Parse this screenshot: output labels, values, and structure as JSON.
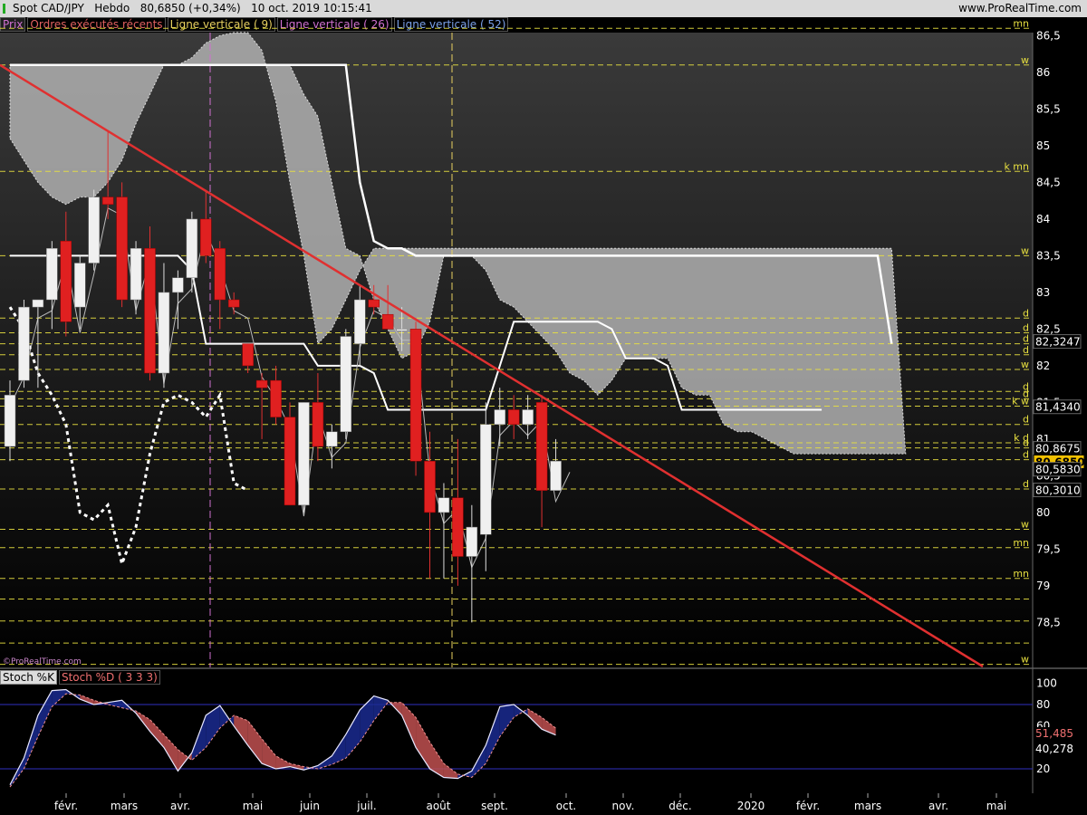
{
  "header": {
    "instrument": "Spot CAD/JPY",
    "timeframe": "Hebdo",
    "price_change": "80,6850 (+0,34%)",
    "datetime": "10 oct. 2019 10:15:41",
    "site": "www.ProRealTime.com"
  },
  "legend": [
    {
      "label": "Prix",
      "color": "#d070d0"
    },
    {
      "label": "Ordres exécutés récents",
      "color": "#e06060"
    },
    {
      "label": "Ligne verticale ( 9)",
      "color": "#e8d060"
    },
    {
      "label": "Ligne verticale ( 26)",
      "color": "#d070d0"
    },
    {
      "label": "Ligne verticale ( 52)",
      "color": "#7aa0e8"
    }
  ],
  "watermark": "©ProRealTime.com",
  "stoch_legend": {
    "k": "Stoch %K",
    "d": "Stoch %D ( 3 3 3)"
  },
  "colors": {
    "up": "#f0f0f0",
    "down": "#e02020",
    "trend": "#e03030",
    "level": "#e8e040",
    "cloud": "#b0b0b0"
  },
  "chart_data": [
    {
      "type": "candlestick",
      "ylim": [
        78.0,
        86.7
      ],
      "yticks": [
        "86,5",
        "86",
        "85,5",
        "85",
        "84,5",
        "84",
        "83,5",
        "83",
        "82,5",
        "82",
        "81,5",
        "81",
        "80,5",
        "80",
        "79,5",
        "79",
        "78,5"
      ],
      "x_labels": [
        "févr.",
        "mars",
        "avr.",
        "mai",
        "juin",
        "juil.",
        "août",
        "sept.",
        "oct.",
        "nov.",
        "déc.",
        "2020",
        "févr.",
        "mars",
        "avr.",
        "mai"
      ],
      "candles": [
        {
          "o": 80.9,
          "h": 81.8,
          "l": 80.7,
          "c": 81.6
        },
        {
          "o": 81.8,
          "h": 82.9,
          "l": 81.7,
          "c": 82.8
        },
        {
          "o": 82.8,
          "h": 82.9,
          "l": 81.7,
          "c": 82.9
        },
        {
          "o": 82.9,
          "h": 83.7,
          "l": 82.5,
          "c": 83.6
        },
        {
          "o": 83.7,
          "h": 84.1,
          "l": 82.4,
          "c": 82.6
        },
        {
          "o": 82.8,
          "h": 83.5,
          "l": 82.5,
          "c": 83.4
        },
        {
          "o": 83.4,
          "h": 84.4,
          "l": 83.3,
          "c": 84.3
        },
        {
          "o": 84.3,
          "h": 85.2,
          "l": 84.0,
          "c": 84.2
        },
        {
          "o": 84.3,
          "h": 84.5,
          "l": 82.8,
          "c": 82.9
        },
        {
          "o": 82.9,
          "h": 83.7,
          "l": 82.7,
          "c": 83.6
        },
        {
          "o": 83.6,
          "h": 83.9,
          "l": 81.8,
          "c": 81.9
        },
        {
          "o": 81.9,
          "h": 83.4,
          "l": 81.7,
          "c": 83.0
        },
        {
          "o": 83.0,
          "h": 83.3,
          "l": 82.5,
          "c": 83.2
        },
        {
          "o": 83.2,
          "h": 84.1,
          "l": 83.0,
          "c": 84.0
        },
        {
          "o": 84.0,
          "h": 84.4,
          "l": 83.4,
          "c": 83.5
        },
        {
          "o": 83.6,
          "h": 83.7,
          "l": 82.5,
          "c": 82.9
        },
        {
          "o": 82.9,
          "h": 83.0,
          "l": 82.7,
          "c": 82.8
        },
        {
          "o": 82.3,
          "h": 82.3,
          "l": 81.9,
          "c": 82.0
        },
        {
          "o": 81.8,
          "h": 81.9,
          "l": 81.0,
          "c": 81.7
        },
        {
          "o": 81.8,
          "h": 82.0,
          "l": 81.2,
          "c": 81.3
        },
        {
          "o": 81.3,
          "h": 81.5,
          "l": 80.1,
          "c": 80.1
        },
        {
          "o": 80.1,
          "h": 81.5,
          "l": 80.0,
          "c": 81.5
        },
        {
          "o": 81.5,
          "h": 81.9,
          "l": 80.7,
          "c": 80.9
        },
        {
          "o": 80.9,
          "h": 81.2,
          "l": 80.6,
          "c": 81.1
        },
        {
          "o": 81.1,
          "h": 82.5,
          "l": 81.0,
          "c": 82.4
        },
        {
          "o": 82.3,
          "h": 83.1,
          "l": 82.0,
          "c": 82.9
        },
        {
          "o": 82.9,
          "h": 83.1,
          "l": 82.7,
          "c": 82.8
        },
        {
          "o": 82.7,
          "h": 83.1,
          "l": 82.5,
          "c": 82.5
        },
        {
          "o": 82.5,
          "h": 82.8,
          "l": 82.2,
          "c": 82.5
        },
        {
          "o": 82.5,
          "h": 82.6,
          "l": 80.5,
          "c": 80.7
        },
        {
          "o": 80.7,
          "h": 81.1,
          "l": 79.1,
          "c": 80.0
        },
        {
          "o": 80.0,
          "h": 80.4,
          "l": 79.1,
          "c": 80.2
        },
        {
          "o": 80.2,
          "h": 81.0,
          "l": 79.0,
          "c": 79.4
        },
        {
          "o": 79.4,
          "h": 80.1,
          "l": 78.5,
          "c": 79.8
        },
        {
          "o": 79.7,
          "h": 81.5,
          "l": 79.2,
          "c": 81.2
        },
        {
          "o": 81.2,
          "h": 81.7,
          "l": 80.9,
          "c": 81.4
        },
        {
          "o": 81.4,
          "h": 81.6,
          "l": 81.0,
          "c": 81.2
        },
        {
          "o": 81.2,
          "h": 81.6,
          "l": 81.0,
          "c": 81.4
        },
        {
          "o": 81.5,
          "h": 81.6,
          "l": 79.8,
          "c": 80.3
        },
        {
          "o": 80.3,
          "h": 81.0,
          "l": 80.3,
          "c": 80.7
        }
      ],
      "price_labels": [
        {
          "label": "82,3247",
          "value": 82.3247,
          "style": "white"
        },
        {
          "label": "81,4340",
          "value": 81.434,
          "style": "white"
        },
        {
          "label": "80,8675",
          "value": 80.8675,
          "style": "white"
        },
        {
          "label": "80,6850",
          "value": 80.685,
          "style": "yellow"
        },
        {
          "label": "80,5830",
          "value": 80.583,
          "style": "white"
        },
        {
          "label": "80,3010",
          "value": 80.301,
          "style": "white"
        }
      ],
      "levels": [
        {
          "value": 86.6,
          "tag": "mn"
        },
        {
          "value": 86.1,
          "tag": "w"
        },
        {
          "value": 84.65,
          "tag": "k mn"
        },
        {
          "value": 83.5,
          "tag": "w"
        },
        {
          "value": 82.65,
          "tag": "d"
        },
        {
          "value": 82.45,
          "tag": "d"
        },
        {
          "value": 82.3,
          "tag": "d"
        },
        {
          "value": 82.15,
          "tag": "d"
        },
        {
          "value": 81.95,
          "tag": "w"
        },
        {
          "value": 81.65,
          "tag": "d"
        },
        {
          "value": 81.55,
          "tag": "d"
        },
        {
          "value": 81.45,
          "tag": "k w"
        },
        {
          "value": 81.2,
          "tag": "d"
        },
        {
          "value": 80.95,
          "tag": "k d"
        },
        {
          "value": 80.88,
          "tag": "d"
        },
        {
          "value": 80.72,
          "tag": "d"
        },
        {
          "value": 80.32,
          "tag": "d"
        },
        {
          "value": 79.77,
          "tag": "w"
        },
        {
          "value": 79.52,
          "tag": "mn"
        },
        {
          "value": 79.1,
          "tag": "mn"
        },
        {
          "value": 78.82,
          "tag": ""
        },
        {
          "value": 78.52,
          "tag": ""
        },
        {
          "value": 78.22,
          "tag": ""
        },
        {
          "value": 77.93,
          "tag": "w"
        }
      ],
      "kijun": [
        86.1,
        86.1,
        86.1,
        86.1,
        86.1,
        86.1,
        86.1,
        86.1,
        86.1,
        86.1,
        86.1,
        86.1,
        86.1,
        86.1,
        86.1,
        86.1,
        86.1,
        86.1,
        86.1,
        86.1,
        86.1,
        86.1,
        86.1,
        86.1,
        86.1,
        84.5,
        83.7,
        83.6,
        83.6,
        83.5,
        83.5,
        83.5,
        83.5,
        83.5,
        83.5,
        83.5,
        83.5,
        83.5,
        83.5,
        83.5,
        83.5,
        83.5,
        83.5,
        83.5,
        83.5,
        83.5,
        83.5,
        83.5,
        83.5,
        83.5,
        83.5,
        83.5,
        83.5,
        83.5,
        83.5,
        83.5,
        83.5,
        83.5,
        83.5,
        83.5,
        83.5,
        83.5,
        83.5,
        82.3
      ],
      "tenkan": [
        83.5,
        83.5,
        83.5,
        83.5,
        83.5,
        83.5,
        83.5,
        83.5,
        83.5,
        83.5,
        83.5,
        83.5,
        83.5,
        83.3,
        82.3,
        82.3,
        82.3,
        82.3,
        82.3,
        82.3,
        82.3,
        82.3,
        82.0,
        82.0,
        82.0,
        82.0,
        81.9,
        81.4,
        81.4,
        81.4,
        81.4,
        81.4,
        81.4,
        81.4,
        81.4,
        82.0,
        82.6,
        82.6,
        82.6,
        82.6,
        82.6,
        82.6,
        82.6,
        82.5,
        82.1,
        82.1,
        82.1,
        82.0,
        81.4,
        81.4,
        81.4,
        81.4,
        81.4,
        81.4,
        81.4,
        81.4,
        81.4,
        81.4,
        81.4
      ],
      "cloud_gray": [
        85.1,
        84.8,
        84.5,
        84.3,
        84.2,
        84.3,
        84.3,
        84.5,
        84.8,
        85.3,
        85.7,
        86.1,
        86.1,
        86.2,
        86.4,
        86.5,
        86.6,
        86.6,
        86.3,
        85.6,
        84.5,
        83.5,
        82.3,
        82.5,
        82.9,
        83.3,
        83.6,
        83.6,
        83.6,
        83.6,
        83.6,
        83.6,
        83.6,
        83.6,
        83.6,
        83.6,
        83.6,
        83.6,
        83.6,
        83.6,
        83.6,
        83.6,
        83.6,
        83.6,
        83.6,
        83.6,
        83.6,
        83.6,
        83.6,
        83.6,
        83.6,
        83.6,
        83.6,
        83.6,
        83.6,
        83.6,
        83.6,
        83.6,
        83.6,
        83.6,
        83.6,
        83.6,
        83.6,
        83.6,
        80.8
      ],
      "cloud_dark": [
        86.1,
        86.1,
        86.1,
        86.1,
        86.1,
        86.1,
        86.1,
        86.1,
        86.1,
        86.1,
        86.1,
        86.1,
        86.1,
        86.1,
        86.1,
        86.1,
        86.1,
        86.1,
        86.1,
        86.1,
        86.1,
        85.7,
        85.4,
        84.5,
        83.6,
        83.5,
        82.9,
        82.5,
        82.1,
        82.2,
        82.6,
        83.5,
        83.5,
        83.5,
        83.3,
        82.9,
        82.8,
        82.6,
        82.4,
        82.2,
        81.9,
        81.8,
        81.6,
        81.8,
        82.1,
        82.1,
        82.1,
        82.1,
        81.7,
        81.6,
        81.6,
        81.2,
        81.1,
        81.1,
        81.0,
        80.9,
        80.8,
        80.8
      ],
      "chikou": [
        82.8,
        82.5,
        81.9,
        81.6,
        81.2,
        80.0,
        79.9,
        80.1,
        79.3,
        79.8,
        80.8,
        81.5,
        81.6,
        81.5,
        81.3,
        81.6,
        80.4,
        80.3
      ],
      "close_line": [
        81.6,
        82.0,
        82.8,
        82.9,
        83.6,
        82.6,
        83.4,
        84.3,
        84.2,
        82.9,
        83.6,
        81.9,
        83.0,
        83.2,
        84.0,
        83.5,
        82.9,
        82.8,
        82.0,
        81.7,
        81.3,
        80.1,
        81.5,
        80.9,
        81.1,
        82.4,
        82.9,
        82.8,
        82.5,
        82.5,
        80.7,
        80.0,
        80.2,
        79.4,
        79.8,
        81.2,
        81.4,
        81.2,
        81.4,
        80.3,
        80.7
      ],
      "trend_line": {
        "from": 86.1,
        "to": 77.9
      },
      "vertical_lines": [
        {
          "color": "#d070d0"
        },
        {
          "color": "#e8d060"
        }
      ]
    },
    {
      "type": "line",
      "ylim": [
        0,
        100
      ],
      "yticks": [
        "100",
        "80",
        "60",
        "20"
      ],
      "bands": [
        80,
        20
      ],
      "series": [
        {
          "name": "Stoch %K",
          "values": [
            5,
            30,
            70,
            93,
            94,
            85,
            80,
            82,
            84,
            72,
            55,
            40,
            18,
            35,
            70,
            79,
            60,
            42,
            25,
            20,
            22,
            19,
            23,
            32,
            52,
            75,
            88,
            84,
            70,
            40,
            20,
            12,
            11,
            18,
            42,
            78,
            80,
            70,
            57,
            51.5
          ]
        },
        {
          "name": "Stoch %D ( 3 3 3)",
          "values": [
            3,
            20,
            50,
            78,
            90,
            89,
            84,
            80,
            77,
            74,
            66,
            52,
            38,
            28,
            40,
            58,
            70,
            65,
            48,
            32,
            25,
            22,
            20,
            24,
            30,
            45,
            65,
            82,
            82,
            68,
            45,
            25,
            15,
            12,
            25,
            50,
            68,
            76,
            68,
            58
          ]
        }
      ],
      "value_labels": [
        {
          "label": "51,485"
        },
        {
          "label": "40,278"
        }
      ]
    }
  ]
}
